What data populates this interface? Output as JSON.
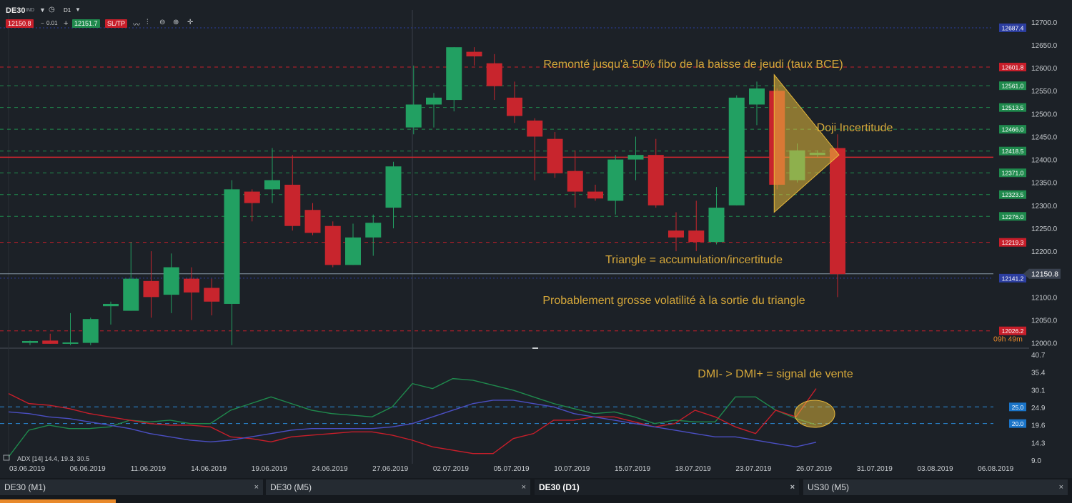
{
  "header": {
    "symbol": "DE30",
    "symbol_sub": "IND",
    "timeframe": "D1",
    "bid": "12150.8",
    "spread": "0.01",
    "ask": "12151.7",
    "sltp_label": "SL/TP",
    "minus": "−",
    "plus": "+"
  },
  "tabs": [
    {
      "label": "DE30 (M1)",
      "active": false
    },
    {
      "label": "DE30 (M5)",
      "active": false
    },
    {
      "label": "DE30 (D1)",
      "active": true
    },
    {
      "label": "US30 (M5)",
      "active": false
    }
  ],
  "tab_close": "×",
  "chart_data": [
    {
      "type": "candlestick",
      "ylim": [
        11990,
        12720
      ],
      "y_ticks": [
        12000,
        12050,
        12100,
        12150,
        12200,
        12250,
        12300,
        12350,
        12400,
        12450,
        12500,
        12550,
        12600,
        12650,
        12700
      ],
      "x_labels": [
        "03.06.2019",
        "06.06.2019",
        "11.06.2019",
        "14.06.2019",
        "19.06.2019",
        "24.06.2019",
        "27.06.2019",
        "02.07.2019",
        "05.07.2019",
        "10.07.2019",
        "15.07.2019",
        "18.07.2019",
        "23.07.2019",
        "26.07.2019",
        "31.07.2019",
        "03.08.2019",
        "06.08.2019"
      ],
      "candles": [
        {
          "o": 12000,
          "h": 12005,
          "l": 11995,
          "c": 12004
        },
        {
          "o": 12005,
          "h": 12020,
          "l": 11998,
          "c": 11998
        },
        {
          "o": 12000,
          "h": 12065,
          "l": 11995,
          "c": 12001
        },
        {
          "o": 12000,
          "h": 12055,
          "l": 11995,
          "c": 12052
        },
        {
          "o": 12080,
          "h": 12090,
          "l": 12040,
          "c": 12085
        },
        {
          "o": 12070,
          "h": 12220,
          "l": 12070,
          "c": 12140
        },
        {
          "o": 12135,
          "h": 12200,
          "l": 12055,
          "c": 12100
        },
        {
          "o": 12105,
          "h": 12195,
          "l": 12065,
          "c": 12165
        },
        {
          "o": 12140,
          "h": 12165,
          "l": 12050,
          "c": 12110
        },
        {
          "o": 12120,
          "h": 12140,
          "l": 12060,
          "c": 12090
        },
        {
          "o": 12085,
          "h": 12355,
          "l": 11995,
          "c": 12335
        },
        {
          "o": 12330,
          "h": 12335,
          "l": 12265,
          "c": 12305
        },
        {
          "o": 12335,
          "h": 12425,
          "l": 12305,
          "c": 12355
        },
        {
          "o": 12345,
          "h": 12410,
          "l": 12245,
          "c": 12255
        },
        {
          "o": 12290,
          "h": 12305,
          "l": 12235,
          "c": 12240
        },
        {
          "o": 12255,
          "h": 12265,
          "l": 12165,
          "c": 12170
        },
        {
          "o": 12170,
          "h": 12260,
          "l": 12170,
          "c": 12230
        },
        {
          "o": 12230,
          "h": 12280,
          "l": 12190,
          "c": 12262
        },
        {
          "o": 12295,
          "h": 12395,
          "l": 12250,
          "c": 12385
        },
        {
          "o": 12470,
          "h": 12605,
          "l": 12455,
          "c": 12520
        },
        {
          "o": 12520,
          "h": 12545,
          "l": 12470,
          "c": 12535
        },
        {
          "o": 12530,
          "h": 12645,
          "l": 12505,
          "c": 12645
        },
        {
          "o": 12635,
          "h": 12645,
          "l": 12605,
          "c": 12625
        },
        {
          "o": 12610,
          "h": 12630,
          "l": 12530,
          "c": 12560
        },
        {
          "o": 12535,
          "h": 12570,
          "l": 12480,
          "c": 12495
        },
        {
          "o": 12485,
          "h": 12490,
          "l": 12355,
          "c": 12450
        },
        {
          "o": 12445,
          "h": 12460,
          "l": 12360,
          "c": 12370
        },
        {
          "o": 12375,
          "h": 12420,
          "l": 12295,
          "c": 12330
        },
        {
          "o": 12330,
          "h": 12345,
          "l": 12310,
          "c": 12315
        },
        {
          "o": 12310,
          "h": 12410,
          "l": 12280,
          "c": 12400
        },
        {
          "o": 12400,
          "h": 12450,
          "l": 12355,
          "c": 12410
        },
        {
          "o": 12410,
          "h": 12445,
          "l": 12295,
          "c": 12300
        },
        {
          "o": 12245,
          "h": 12285,
          "l": 12200,
          "c": 12230
        },
        {
          "o": 12245,
          "h": 12310,
          "l": 12200,
          "c": 12220
        },
        {
          "o": 12220,
          "h": 12340,
          "l": 12215,
          "c": 12295
        },
        {
          "o": 12300,
          "h": 12540,
          "l": 12300,
          "c": 12535
        },
        {
          "o": 12520,
          "h": 12570,
          "l": 12475,
          "c": 12555
        },
        {
          "o": 12550,
          "h": 12555,
          "l": 12335,
          "c": 12345
        },
        {
          "o": 12355,
          "h": 12435,
          "l": 12350,
          "c": 12420
        },
        {
          "o": 12410,
          "h": 12420,
          "l": 12405,
          "c": 12415
        },
        {
          "o": 12425,
          "h": 12455,
          "l": 12100,
          "c": 12150
        }
      ],
      "price_levels": [
        {
          "label": "12687.4",
          "value": 12687.4,
          "color": "#2c3ea0",
          "style": "dotted"
        },
        {
          "label": "12601.8",
          "value": 12601.8,
          "color": "#c81e2a",
          "style": "dashed"
        },
        {
          "label": "12561.0",
          "value": 12561.0,
          "color": "#1f8a4d",
          "style": "dashed"
        },
        {
          "label": "12513.5",
          "value": 12513.5,
          "color": "#1f8a4d",
          "style": "dashed"
        },
        {
          "label": "12466.0",
          "value": 12466.0,
          "color": "#1f8a4d",
          "style": "dashed"
        },
        {
          "label": "12418.5",
          "value": 12418.5,
          "color": "#1f8a4d",
          "style": "dashed"
        },
        {
          "label": "12371.0",
          "value": 12371.0,
          "color": "#1f8a4d",
          "style": "dashed"
        },
        {
          "label": "12323.5",
          "value": 12323.5,
          "color": "#1f8a4d",
          "style": "dashed"
        },
        {
          "label": "12276.0",
          "value": 12276.0,
          "color": "#1f8a4d",
          "style": "dashed"
        },
        {
          "label": "12219.3",
          "value": 12219.3,
          "color": "#c81e2a",
          "style": "dashed"
        },
        {
          "label": "12141.2",
          "value": 12141.2,
          "color": "#2c3ea0",
          "style": "dotted"
        },
        {
          "label": "12026.2",
          "value": 12026.2,
          "color": "#c81e2a",
          "style": "dashed"
        }
      ],
      "solid_red_level": 12405,
      "current_price": {
        "label": "12150.8",
        "value": 12150.8
      },
      "countdown": "09h 49m",
      "triangle": {
        "from_index": 37,
        "to_index": 40,
        "top": 12585,
        "bottom": 12285,
        "apex": 12410
      },
      "annotations": [
        {
          "text": "Remonté jusqu'à 50% fibo de la baisse de jeudi (taux BCE)"
        },
        {
          "text": "Doji Incertitude"
        },
        {
          "text": "Triangle = accumulation/incertitude"
        },
        {
          "text": "Probablement grosse volatilité à la sortie du triangle"
        }
      ]
    },
    {
      "type": "line",
      "title": "ADX [14] 14.4, 19.3, 30.5",
      "ylim": [
        9.0,
        40.7
      ],
      "y_ticks": [
        "40.7",
        "35.4",
        "30.1",
        "24.9",
        "19.6",
        "14.3",
        "9.0"
      ],
      "levels": [
        {
          "label": "25.0",
          "value": 25.0
        },
        {
          "label": "20.0",
          "value": 20.0
        }
      ],
      "annotation": "DMI- > DMI+ = signal de vente",
      "series": [
        {
          "color": "#1f8a4d",
          "values": [
            10,
            18,
            19.5,
            18.5,
            18.5,
            19,
            21,
            20.5,
            21,
            20,
            20,
            24,
            26,
            28,
            26,
            24,
            23,
            22.5,
            22,
            25,
            32,
            30.5,
            33.5,
            33,
            31.5,
            30,
            28,
            26,
            24.5,
            23,
            23.5,
            22,
            20,
            21,
            20.5,
            20.5,
            28,
            28,
            24,
            21.5,
            19.6
          ]
        },
        {
          "color": "#c81e2a",
          "values": [
            29,
            26,
            25.5,
            24.5,
            23,
            22,
            21,
            20,
            19.5,
            19.5,
            19,
            16,
            15.5,
            14.5,
            16,
            16.5,
            17,
            17.5,
            17.5,
            16.5,
            15,
            13,
            12,
            11,
            11,
            15.5,
            17,
            21,
            21,
            22,
            22,
            20.5,
            19,
            20,
            24,
            22,
            19,
            17,
            24,
            22,
            30.5
          ]
        },
        {
          "color": "#4b4fc4",
          "values": [
            23.5,
            23,
            22,
            21.5,
            20.5,
            19.5,
            18.5,
            17,
            16,
            15,
            14.5,
            15,
            16,
            17,
            18,
            18.5,
            18.5,
            18.5,
            18.5,
            19,
            20,
            22,
            24,
            26,
            27,
            27,
            26,
            25,
            23,
            22,
            21,
            20,
            19,
            18,
            17,
            16,
            16,
            15,
            14,
            13,
            14.4
          ]
        }
      ]
    }
  ]
}
